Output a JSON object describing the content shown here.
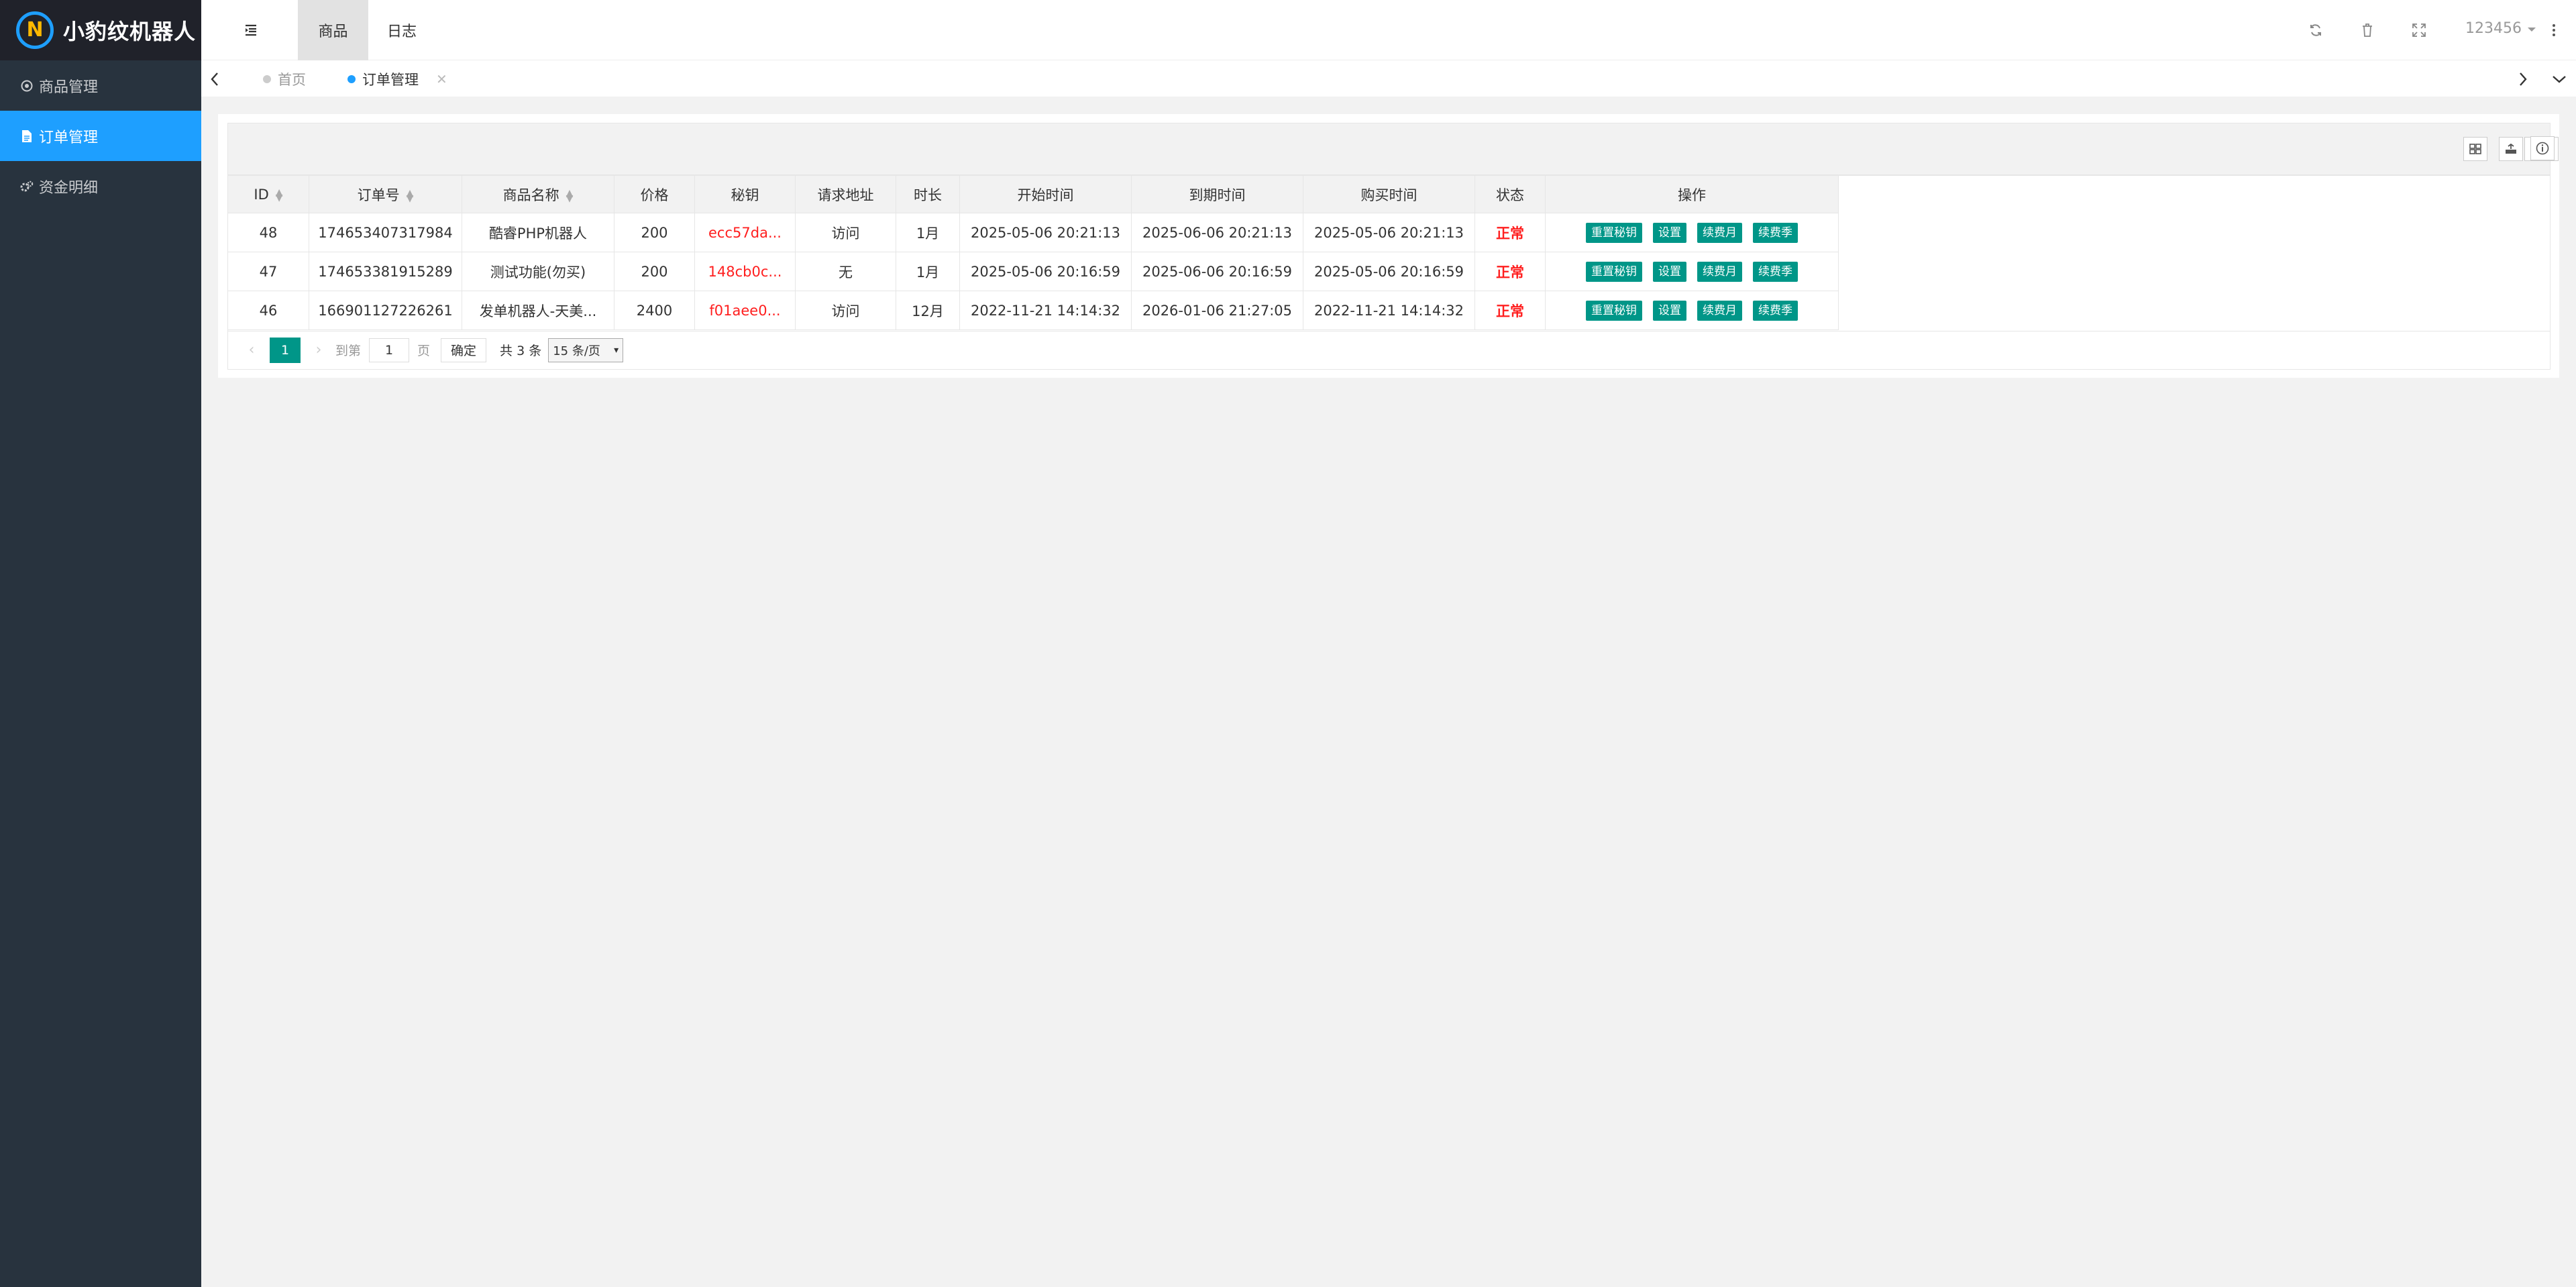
{
  "app": {
    "name": "小豹纹机器人",
    "logo_letter": "N"
  },
  "sidebar": {
    "items": [
      {
        "label": "商品管理",
        "icon": "circle-play-icon"
      },
      {
        "label": "订单管理",
        "icon": "file-icon"
      },
      {
        "label": "资金明细",
        "icon": "gears-icon"
      }
    ]
  },
  "header": {
    "tabs": [
      {
        "label": "商品"
      },
      {
        "label": "日志"
      }
    ],
    "user": "123456"
  },
  "page_tabs": [
    {
      "label": "首页"
    },
    {
      "label": "订单管理"
    }
  ],
  "table": {
    "columns": [
      "ID",
      "订单号",
      "商品名称",
      "价格",
      "秘钥",
      "请求地址",
      "时长",
      "开始时间",
      "到期时间",
      "购买时间",
      "状态",
      "操作"
    ],
    "rows": [
      {
        "id": "48",
        "order": "174653407317984",
        "name": "酷睿PHP机器人",
        "price": "200",
        "key": "ecc57da...",
        "addr": "访问",
        "dur": "1月",
        "start": "2025-05-06 20:21:13",
        "end": "2025-06-06 20:21:13",
        "buy": "2025-05-06 20:21:13",
        "status": "正常"
      },
      {
        "id": "47",
        "order": "174653381915289",
        "name": "测试功能(勿买)",
        "price": "200",
        "key": "148cb0c...",
        "addr": "无",
        "dur": "1月",
        "start": "2025-05-06 20:16:59",
        "end": "2025-06-06 20:16:59",
        "buy": "2025-05-06 20:16:59",
        "status": "正常"
      },
      {
        "id": "46",
        "order": "166901127226261",
        "name": "发单机器人-天美...",
        "price": "2400",
        "key": "f01aee0...",
        "addr": "访问",
        "dur": "12月",
        "start": "2022-11-21 14:14:32",
        "end": "2026-01-06 21:27:05",
        "buy": "2022-11-21 14:14:32",
        "status": "正常"
      }
    ],
    "actions": [
      "重置秘钥",
      "设置",
      "续费月",
      "续费季"
    ]
  },
  "pager": {
    "current": "1",
    "goto_label": "到第",
    "goto_value": "1",
    "page_label": "页",
    "confirm": "确定",
    "total": "共 3 条",
    "page_size": "15 条/页"
  },
  "colors": {
    "accent": "#1e9fff",
    "green": "#009688",
    "sidebar": "#28333e",
    "danger": "#ff1e1e"
  }
}
